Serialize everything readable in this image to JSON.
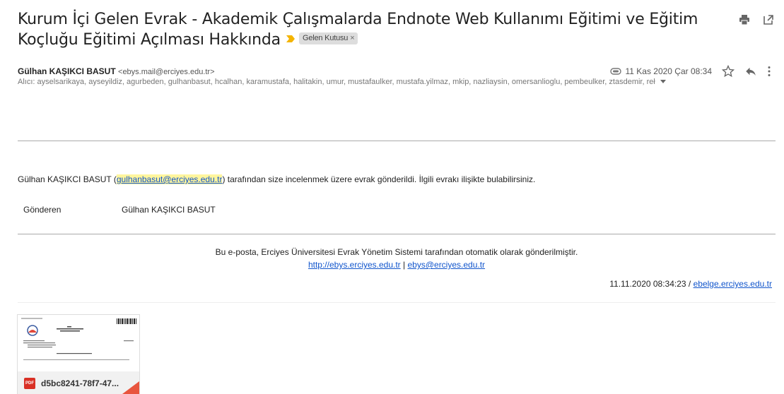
{
  "subject": {
    "title": "Kurum İçi Gelen Evrak - Akademik Çalışmalarda Endnote Web Kullanımı Eğitimi ve Eğitim Koçluğu Eğitimi Açılması Hakkında",
    "label": "Gelen Kutusu",
    "label_close": "×"
  },
  "icons": {
    "print": "print-icon",
    "open_new_window": "open-in-new-window-icon",
    "attachment": "attachment-icon",
    "star": "star-icon",
    "reply": "reply-icon",
    "more": "more-vert-icon",
    "expand": "dropdown-arrow-icon",
    "important": "important-marker-icon",
    "pdf": "pdf-icon"
  },
  "message": {
    "sender_name": "Gülhan KAŞIKCI BASUT",
    "sender_email": "<ebys.mail@erciyes.edu.tr>",
    "recipients": "Alıcı: ayselsarikaya, ayseyildiz, agurbeden, gulhanbasut, hcalhan, karamustafa, halitakin, umur, mustafaulker, mustafa.yilmaz, mkip, nazliaysin, omersanlioglu, pembeulker, ztasdemir, reł",
    "date": "11 Kas 2020 Çar 08:34"
  },
  "body": {
    "intro_before": "Gülhan KAŞIKCI BASUT (",
    "intro_link": "gulhanbasut@erciyes.edu.tr",
    "intro_after": ") tarafından size incelenmek üzere evrak gönderildi. İlgili evrakı ilişikte bulabilirsiniz.",
    "sender_label": "Gönderen",
    "sender_value": "Gülhan KAŞIKCI BASUT"
  },
  "footer": {
    "notice": "Bu e-posta, Erciyes Üniversitesi Evrak Yönetim Sistemi tarafından otomatik olarak gönderilmiştir.",
    "link1": "http://ebys.erciyes.edu.tr",
    "separator": " | ",
    "link2": "ebys@erciyes.edu.tr",
    "timestamp": "11.11.2020 08:34:23 / ",
    "timestamp_link": "ebelge.erciyes.edu.tr"
  },
  "attachment": {
    "filename": "d5bc8241-78f7-47...",
    "type_badge": "PDF"
  },
  "colors": {
    "link": "#1155cc",
    "highlight": "#fff59d",
    "important": "#f4b400",
    "pdf": "#d93025"
  }
}
